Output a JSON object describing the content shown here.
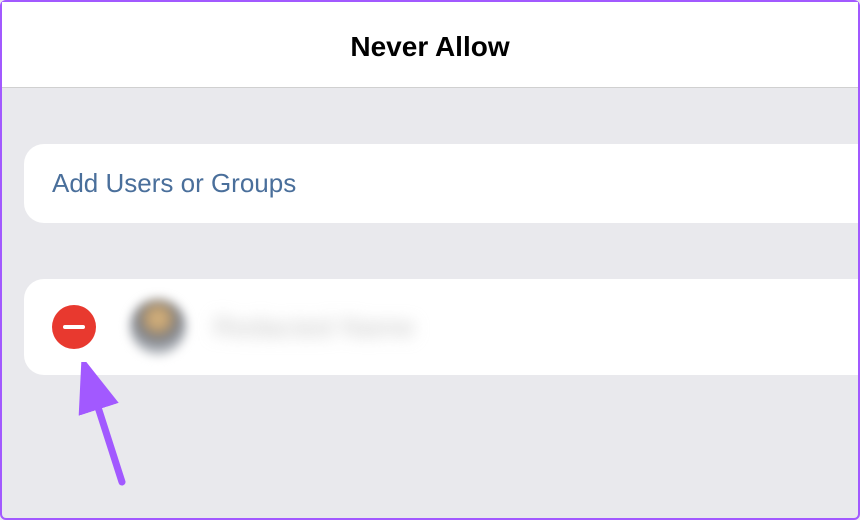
{
  "header": {
    "title": "Never Allow"
  },
  "actions": {
    "add_link_label": "Add Users or Groups"
  },
  "users": [
    {
      "name": "Redacted Name",
      "avatar": "blurred"
    }
  ],
  "icons": {
    "remove": "minus-circle"
  },
  "annotation": {
    "arrow_color": "#a259ff"
  }
}
